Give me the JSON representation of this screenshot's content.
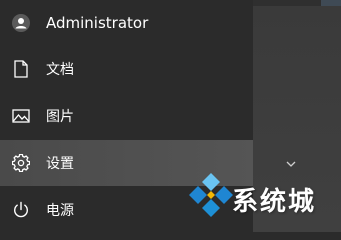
{
  "menu": {
    "user": {
      "label": "Administrator",
      "icon": "user-avatar-icon"
    },
    "items": [
      {
        "label": "文档",
        "icon": "document-icon"
      },
      {
        "label": "图片",
        "icon": "picture-icon"
      },
      {
        "label": "设置",
        "icon": "gear-icon"
      },
      {
        "label": "电源",
        "icon": "power-icon"
      }
    ]
  },
  "right_panel": {
    "expand_icon": "chevron-down-icon"
  },
  "watermark": {
    "text": "系统城",
    "icon": "windows-logo-icon"
  },
  "colors": {
    "background": "#2b2b2b",
    "hover": "#4f4f4f",
    "text": "#ffffff",
    "logo_blue": "#1e90d6"
  }
}
